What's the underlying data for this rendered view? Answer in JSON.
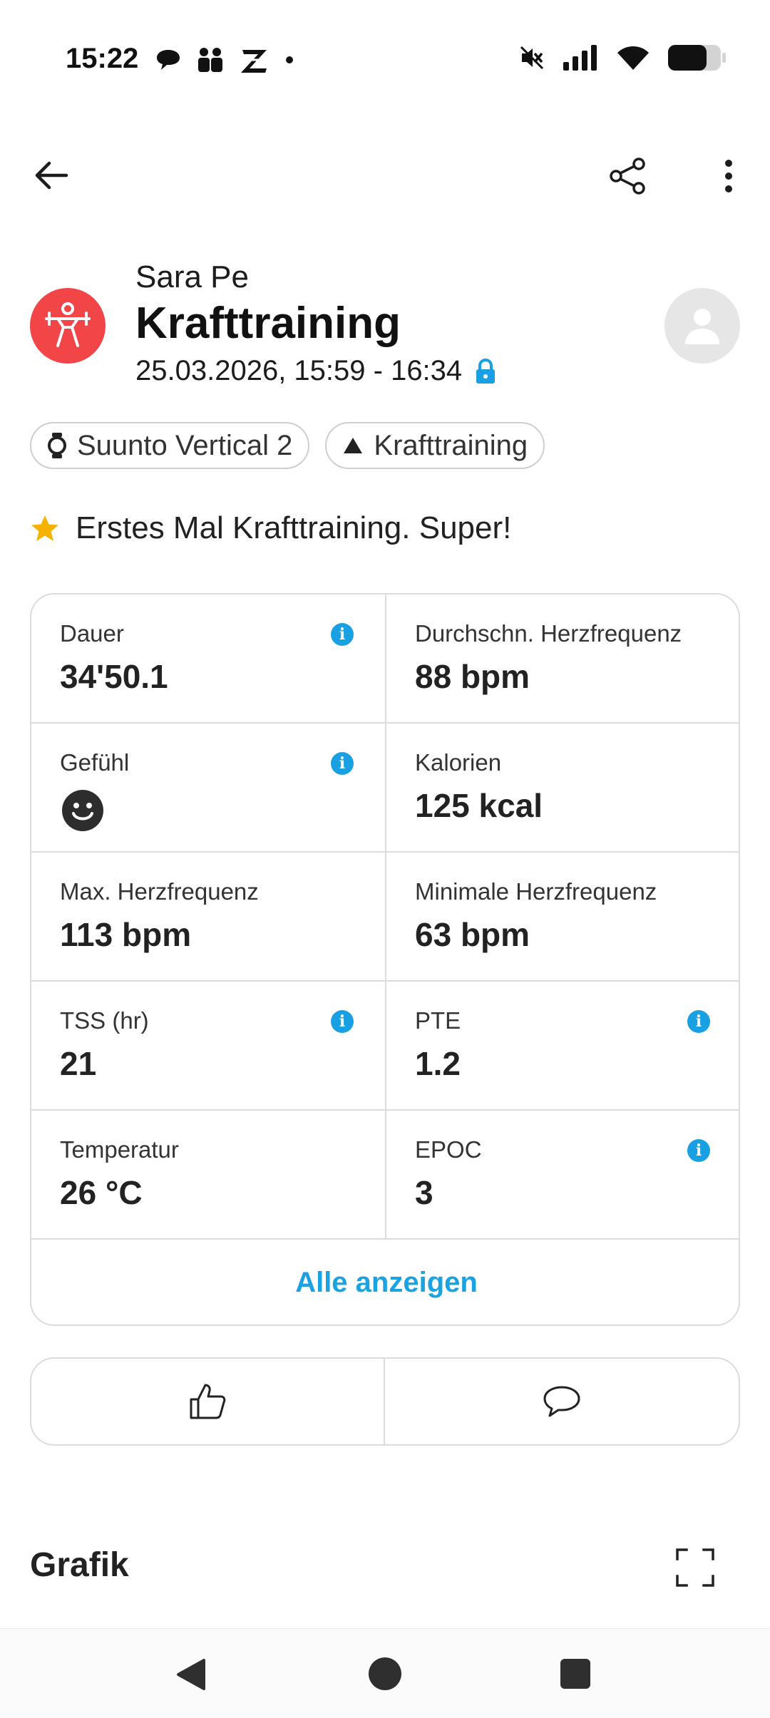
{
  "status_bar": {
    "time": "15:22",
    "left_icons": [
      "chat-bubble-icon",
      "people-icon",
      "z-app-icon",
      "dot-icon"
    ],
    "right_icons": [
      "mute-icon",
      "signal-icon",
      "wifi-icon",
      "battery-icon"
    ]
  },
  "header": {
    "user_name": "Sara Pe",
    "activity_title": "Krafttraining",
    "date_range": "25.03.2026, 15:59 - 16:34"
  },
  "chips": [
    {
      "label": "Suunto Vertical 2",
      "icon": "watch-icon"
    },
    {
      "label": "Krafttraining",
      "icon": "triangle-icon"
    }
  ],
  "achievement": {
    "text": "Erstes Mal Krafttraining. Super!",
    "icon": "star-icon"
  },
  "stats": [
    {
      "label": "Dauer",
      "value": "34'50.1",
      "info": true
    },
    {
      "label": "Durchschn. Herzfrequenz",
      "value": "88 bpm",
      "info": false
    },
    {
      "label": "Gefühl",
      "value": "",
      "info": true
    },
    {
      "label": "Kalorien",
      "value": "125 kcal",
      "info": false
    },
    {
      "label": "Max. Herzfrequenz",
      "value": "113 bpm",
      "info": false
    },
    {
      "label": "Minimale Herzfrequenz",
      "value": "63 bpm",
      "info": false
    },
    {
      "label": "TSS (hr)",
      "value": "21",
      "info": true
    },
    {
      "label": "PTE",
      "value": "1.2",
      "info": true
    },
    {
      "label": "Temperatur",
      "value": "26 °C",
      "info": false
    },
    {
      "label": "EPOC",
      "value": "3",
      "info": true
    }
  ],
  "show_all_label": "Alle anzeigen",
  "section_title": "Grafik",
  "colors": {
    "accent": "#1aa3e3",
    "activity_icon_bg": "#f24548",
    "star": "#f5b300",
    "border": "#dcdcdc"
  }
}
